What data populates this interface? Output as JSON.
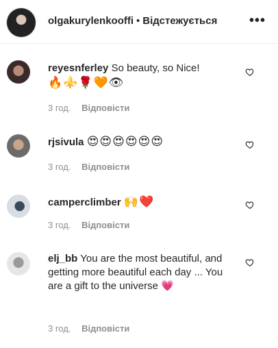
{
  "header": {
    "username": "olgakurylenkooffi",
    "separator": "•",
    "follow_status": "Відстежується",
    "more_label": "•••"
  },
  "comments": [
    {
      "username": "reyesnferley",
      "text": "So beauty, so Nice!",
      "emojis": "🔥⚜️🌹🧡👁",
      "time": "3 год.",
      "reply": "Відповісти"
    },
    {
      "username": "rjsivula",
      "text": "😍😍😍😍😍😍",
      "time": "3 год.",
      "reply": "Відповісти"
    },
    {
      "username": "camperclimber",
      "text": "🙌❤️",
      "time": "3 год.",
      "reply": "Відповісти"
    },
    {
      "username": "elj_bb",
      "text": "You are the most beautiful, and getting more beautiful each day ... You are a gift to the universe 💗",
      "time": "3 год.",
      "reply": "Відповісти"
    }
  ],
  "icons": {
    "like": "heart-outline-icon",
    "more": "more-options-icon"
  },
  "colors": {
    "text": "#262626",
    "meta": "#8e8e8e",
    "divider": "#efefef"
  }
}
